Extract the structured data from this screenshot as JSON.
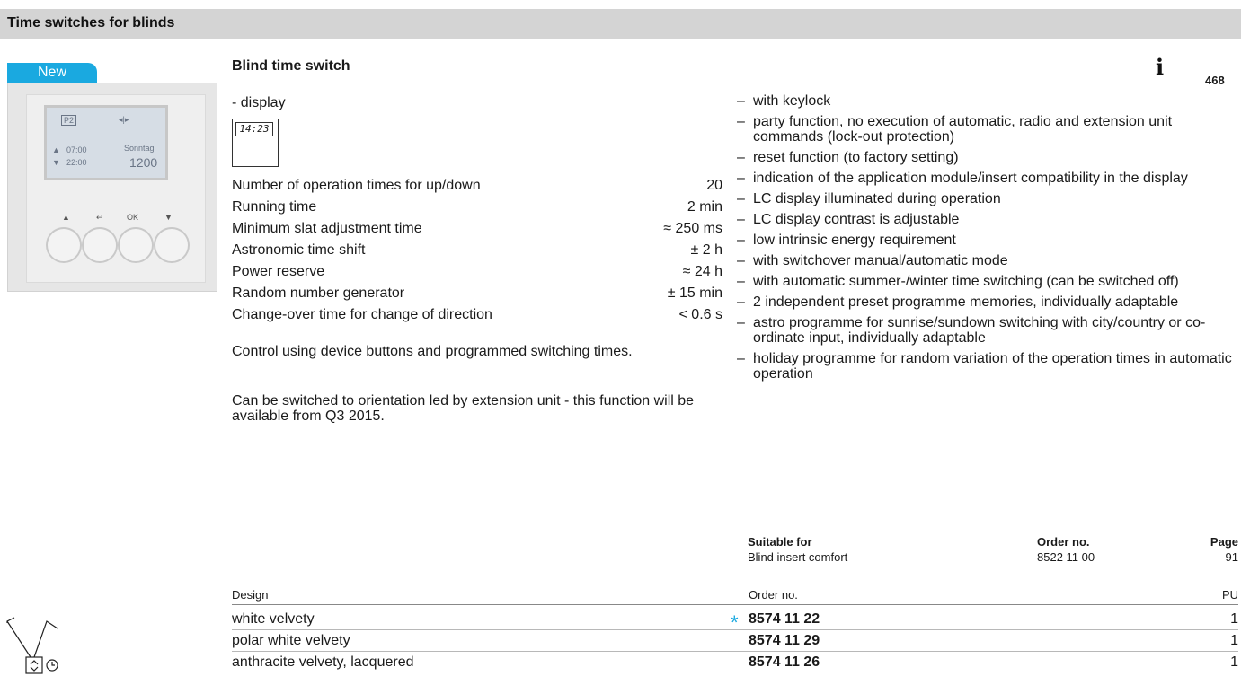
{
  "header": {
    "title": "Time switches for blinds"
  },
  "badge": {
    "label": "New"
  },
  "device": {
    "screen_code": "P2",
    "screen_icon": "◂|▸",
    "time_up": "07:00",
    "time_down": "22:00",
    "day": "Sonntag",
    "clock": "1200",
    "button_labels": [
      "▲",
      "↩",
      "OK",
      "▼"
    ]
  },
  "product": {
    "title": "Blind time switch",
    "info_icon": "i",
    "page_ref": "468",
    "display_label": "- display",
    "lcd_text": "14:23"
  },
  "specs": [
    {
      "label": "Number of operation times for up/down",
      "value": "20"
    },
    {
      "label": "Running time",
      "value": "2 min"
    },
    {
      "label": "Minimum slat adjustment time",
      "value": "≈ 250 ms"
    },
    {
      "label": "Astronomic time shift",
      "value": "± 2 h"
    },
    {
      "label": "Power reserve",
      "value": "≈ 24 h"
    },
    {
      "label": "Random number generator",
      "value": "± 15 min"
    },
    {
      "label": "Change-over time for change of direction",
      "value": "< 0.6 s"
    }
  ],
  "paragraphs": [
    "Control using device buttons and programmed switching times.",
    "Can be switched to orientation led by extension unit - this function will be available from Q3 2015."
  ],
  "features": [
    "with keylock",
    "party function, no execution of automatic, radio and extension unit commands (lock-out protection)",
    "reset function (to factory setting)",
    "indication of the application module/insert compatibility in the display",
    "LC display illuminated during operation",
    "LC display contrast is adjustable",
    "low intrinsic energy requirement",
    "with switchover manual/automatic mode",
    "with automatic summer-/winter time switching (can be switched off)",
    "2 independent preset programme memories, individually adaptable",
    "astro programme for sunrise/sundown switching with city/country or co-ordinate input, individually adaptable",
    "holiday programme for random variation of the operation times in automatic operation"
  ],
  "suitable": {
    "headers": {
      "suitable_for": "Suitable for",
      "order_no": "Order no.",
      "page": "Page"
    },
    "row": {
      "name": "Blind insert comfort",
      "order_no": "8522 11 00",
      "page": "91"
    }
  },
  "design_table": {
    "headers": {
      "design": "Design",
      "order_no": "Order no.",
      "pu": "PU"
    },
    "rows": [
      {
        "design": "white velvety",
        "star": "*",
        "order_no": "8574 11 22",
        "pu": "1"
      },
      {
        "design": "polar white velvety",
        "order_no": "8574 11 29",
        "pu": "1"
      },
      {
        "design": "anthracite velvety, lacquered",
        "order_no": "8574 11 26",
        "pu": "1"
      }
    ]
  },
  "colors": {
    "accent": "#1aa9e0",
    "header_bg": "#d4d4d4"
  }
}
